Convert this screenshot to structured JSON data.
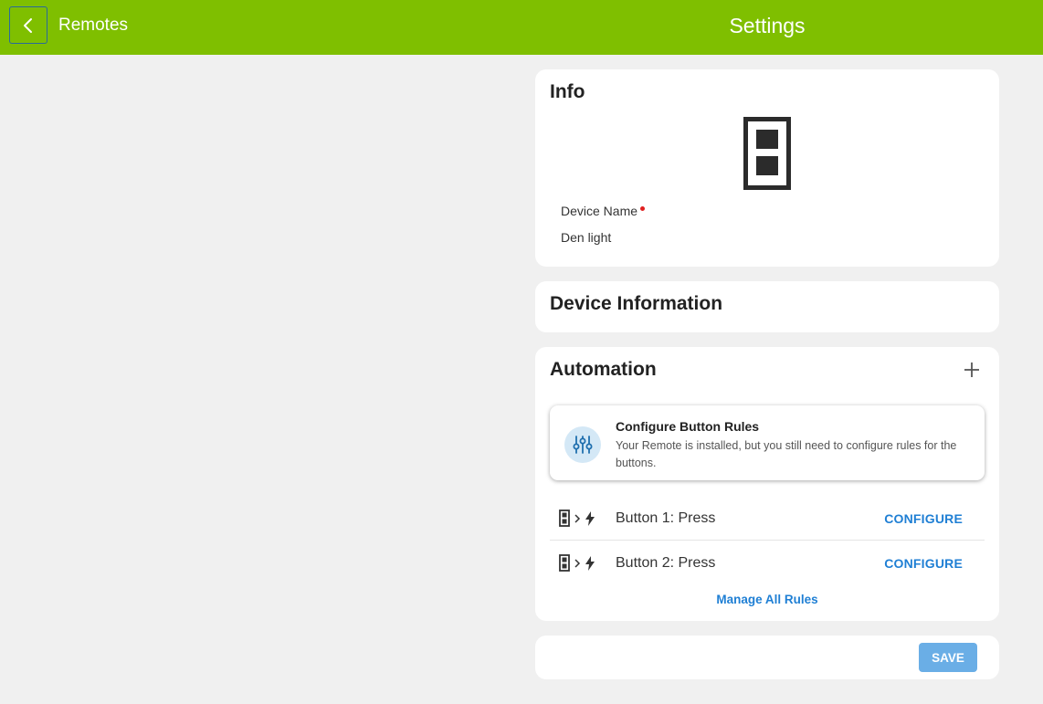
{
  "header": {
    "back_label": "Remotes",
    "title": "Settings",
    "back_icon": "chevron-left-icon"
  },
  "info": {
    "title": "Info",
    "device_icon": "remote-device-icon",
    "device_name_label": "Device Name",
    "device_name_value": "Den light"
  },
  "device_information": {
    "title": "Device Information"
  },
  "automation": {
    "title": "Automation",
    "add_icon": "plus-icon",
    "notice": {
      "icon": "sliders-icon",
      "title": "Configure Button Rules",
      "text": "Your Remote is installed, but you still need to configure rules for the buttons."
    },
    "rules": [
      {
        "label": "Button 1: Press",
        "action": "CONFIGURE"
      },
      {
        "label": "Button 2: Press",
        "action": "CONFIGURE"
      }
    ],
    "manage_link": "Manage All Rules"
  },
  "footer": {
    "save_label": "SAVE"
  },
  "colors": {
    "header_bg": "#7fbf00",
    "link": "#1f7fd4",
    "save_bg": "#6aaee6",
    "required": "#e02020"
  }
}
